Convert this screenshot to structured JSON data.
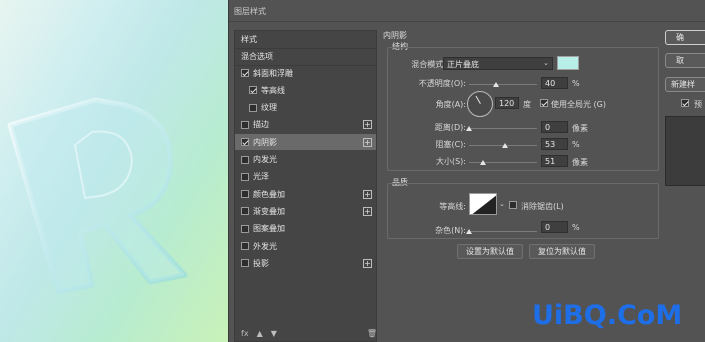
{
  "window": {
    "title": "图层样式"
  },
  "style_list": {
    "header": "样式",
    "blend_options": "混合选项",
    "items": [
      {
        "label": "斜面和浮雕",
        "checked": true,
        "indent": false,
        "plus": false
      },
      {
        "label": "等高线",
        "checked": true,
        "indent": true,
        "plus": false
      },
      {
        "label": "纹理",
        "checked": false,
        "indent": true,
        "plus": false
      },
      {
        "label": "描边",
        "checked": false,
        "indent": false,
        "plus": true
      },
      {
        "label": "内阴影",
        "checked": true,
        "indent": false,
        "plus": true,
        "selected": true
      },
      {
        "label": "内发光",
        "checked": false,
        "indent": false,
        "plus": false
      },
      {
        "label": "光泽",
        "checked": false,
        "indent": false,
        "plus": false
      },
      {
        "label": "颜色叠加",
        "checked": false,
        "indent": false,
        "plus": true
      },
      {
        "label": "渐变叠加",
        "checked": false,
        "indent": false,
        "plus": true
      },
      {
        "label": "图案叠加",
        "checked": false,
        "indent": false,
        "plus": false
      },
      {
        "label": "外发光",
        "checked": false,
        "indent": false,
        "plus": false
      },
      {
        "label": "投影",
        "checked": false,
        "indent": false,
        "plus": true
      }
    ],
    "fx_label": "fx",
    "fx_icons": [
      "up-arrow-icon",
      "down-arrow-icon",
      "trash-icon"
    ]
  },
  "inner_shadow": {
    "section_title": "内阴影",
    "structure_title": "结构",
    "blend_mode_label": "混合模式:",
    "blend_mode_value": "正片叠底",
    "color": "#b7efe8",
    "opacity_label": "不透明度(O):",
    "opacity_value": "40",
    "opacity_unit": "%",
    "opacity_fraction": 0.4,
    "angle_label": "角度(A):",
    "angle_value": "120",
    "angle_unit": "度",
    "global_light_label": "使用全局光 (G)",
    "global_light_checked": true,
    "distance_label": "距离(D):",
    "distance_value": "0",
    "distance_unit": "像素",
    "distance_fraction": 0.0,
    "choke_label": "阻塞(C):",
    "choke_value": "53",
    "choke_unit": "%",
    "choke_fraction": 0.53,
    "size_label": "大小(S):",
    "size_value": "51",
    "size_unit": "像素",
    "size_fraction": 0.2,
    "quality_title": "品质",
    "contour_label": "等高线:",
    "anti_alias_label": "消除锯齿(L)",
    "anti_alias_checked": false,
    "noise_label": "杂色(N):",
    "noise_value": "0",
    "noise_unit": "%",
    "noise_fraction": 0.0,
    "make_default_label": "设置为默认值",
    "reset_default_label": "复位为默认值"
  },
  "right_panel": {
    "ok_label": "确",
    "cancel_label": "取",
    "new_style_label": "新建样",
    "preview_label": "预",
    "preview_checked": true
  },
  "watermark": "UiBQ.CoM",
  "colors": {
    "accent": "#1e6ee8",
    "panel": "#535353",
    "list": "#454545"
  }
}
